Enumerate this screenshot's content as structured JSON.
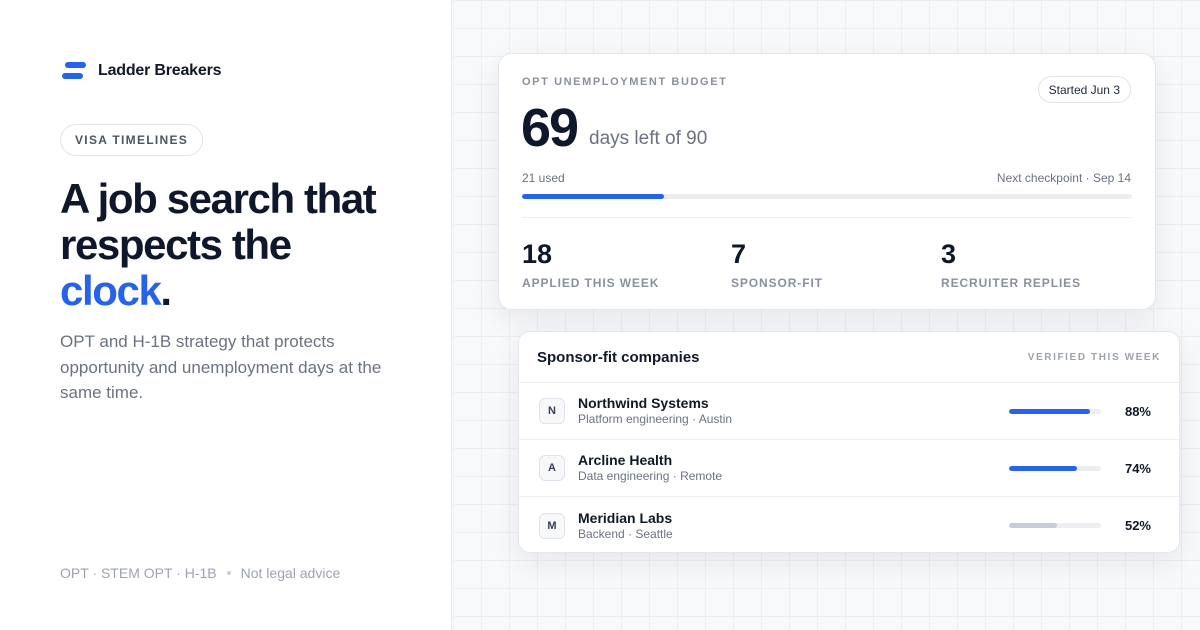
{
  "brand": {
    "name": "Ladder Breakers",
    "accent": "#2563eb"
  },
  "pill": "VISA TIMELINES",
  "headline": {
    "line1": "A job search that",
    "line2": "respects the",
    "accent_word": "clock",
    "end": "."
  },
  "subheadline": "OPT and H-1B strategy that protects opportunity and unemployment days at the same time.",
  "footer": {
    "visas": "OPT · STEM OPT · H-1B",
    "disclaimer": "Not legal advice"
  },
  "budget": {
    "label": "OPT UNEMPLOYMENT BUDGET",
    "started": "Started Jun 3",
    "days_left": "69",
    "suffix": "days left of 90",
    "used_text": "21 used",
    "used_fraction": 0.2333,
    "next_checkpoint": "Next checkpoint · Sep 14",
    "stats": [
      {
        "value": "18",
        "label": "APPLIED THIS WEEK"
      },
      {
        "value": "7",
        "label": "SPONSOR-FIT"
      },
      {
        "value": "3",
        "label": "RECRUITER REPLIES"
      }
    ]
  },
  "companies": {
    "title": "Sponsor-fit companies",
    "verified": "VERIFIED THIS WEEK",
    "rows": [
      {
        "initial": "N",
        "name": "Northwind Systems",
        "desc": "Platform engineering · Austin",
        "pct": "88%",
        "value": 0.88,
        "color": "#2563eb"
      },
      {
        "initial": "A",
        "name": "Arcline Health",
        "desc": "Data engineering · Remote",
        "pct": "74%",
        "value": 0.74,
        "color": "#2563eb"
      },
      {
        "initial": "M",
        "name": "Meridian Labs",
        "desc": "Backend · Seattle",
        "pct": "52%",
        "value": 0.52,
        "color": "#c7ccd6"
      }
    ]
  }
}
